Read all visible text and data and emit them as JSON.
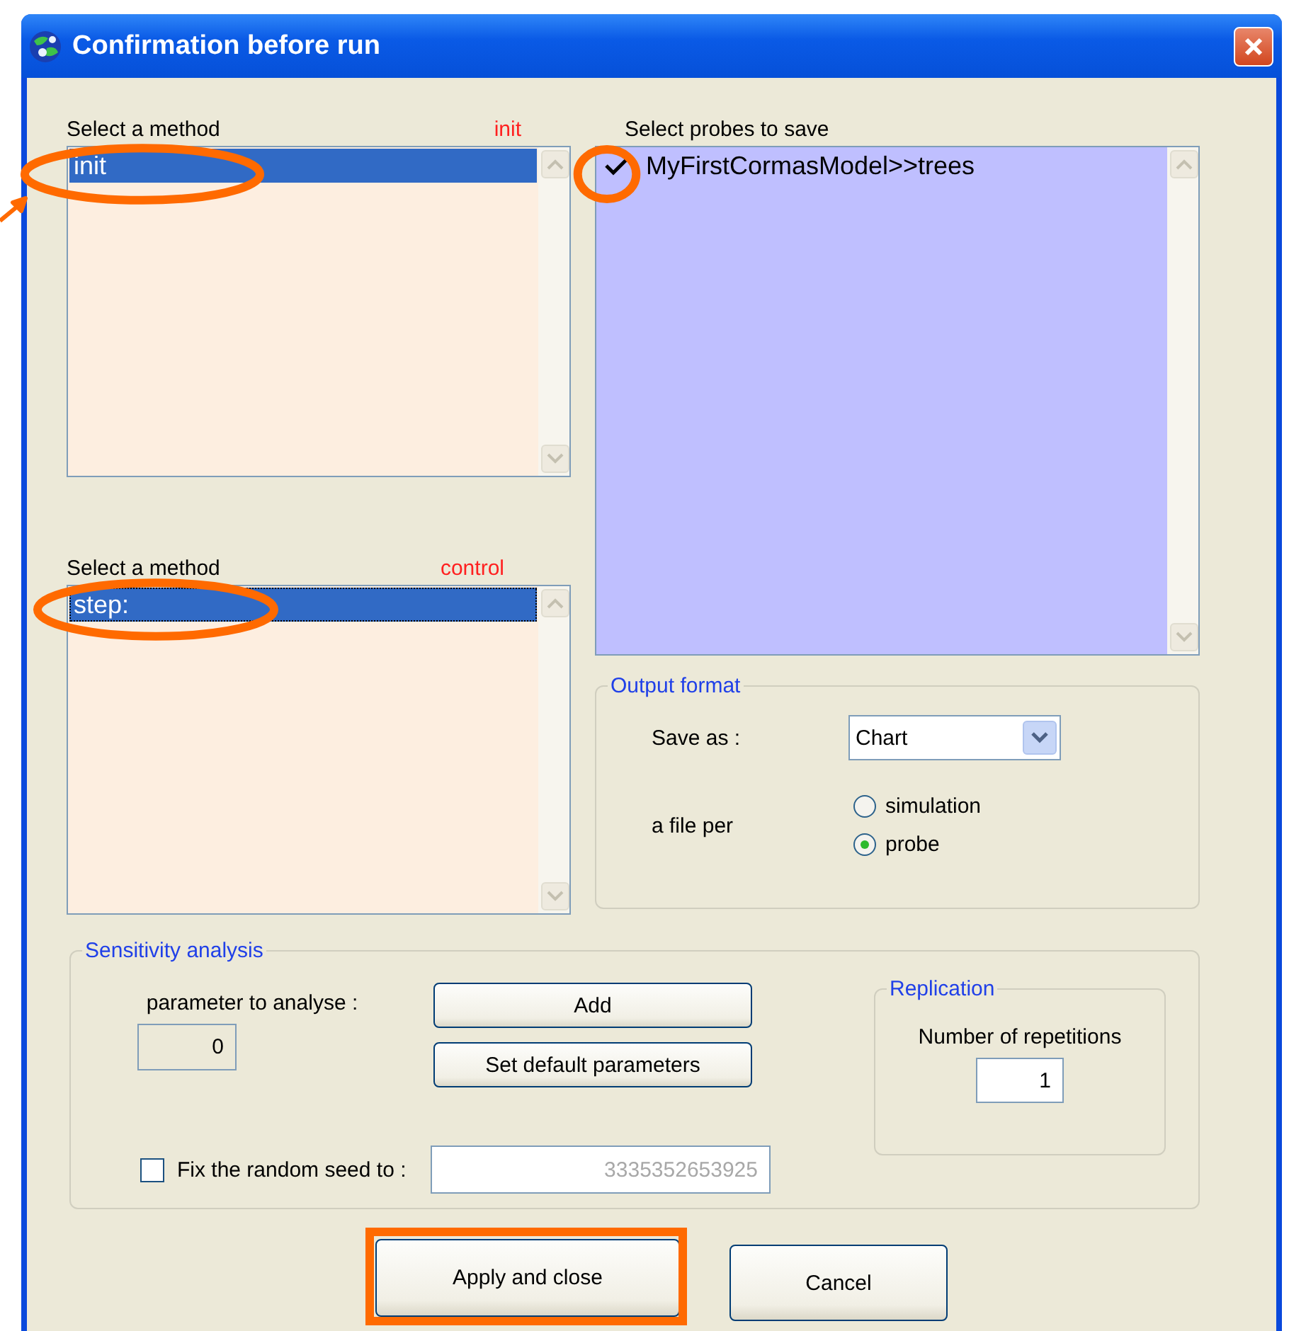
{
  "window": {
    "title": "Confirmation before run"
  },
  "init_method": {
    "label": "Select a method",
    "category": "init",
    "items": [
      {
        "text": "init",
        "selected": true,
        "focused": false,
        "circled": true
      }
    ]
  },
  "control_method": {
    "label": "Select a method",
    "category": "control",
    "items": [
      {
        "text": "step:",
        "selected": true,
        "focused": true,
        "circled": true
      }
    ]
  },
  "probes": {
    "label": "Select probes to save",
    "items": [
      {
        "text": "MyFirstCormasModel>>trees",
        "checked": true,
        "circled": true
      }
    ]
  },
  "output_format": {
    "title": "Output format",
    "save_as": {
      "label": "Save as :",
      "value": "Chart"
    },
    "file_per": {
      "label": "a file per",
      "options": [
        {
          "label": "simulation",
          "selected": false
        },
        {
          "label": "probe",
          "selected": true
        }
      ]
    }
  },
  "sensitivity": {
    "title": "Sensitivity analysis",
    "parameter_label": "parameter to analyse :",
    "parameter_value": "0",
    "buttons": [
      {
        "label": "Add"
      },
      {
        "label": "Set default parameters"
      }
    ],
    "fix_seed": {
      "label": "Fix the random seed to :",
      "checked": false,
      "value": "3335352653925"
    },
    "replication": {
      "title": "Replication",
      "label": "Number of repetitions",
      "value": "1"
    }
  },
  "buttons": [
    {
      "label": "Apply and close",
      "boxed": true
    },
    {
      "label": "Cancel",
      "boxed": false
    }
  ],
  "pointer_arrow": true
}
